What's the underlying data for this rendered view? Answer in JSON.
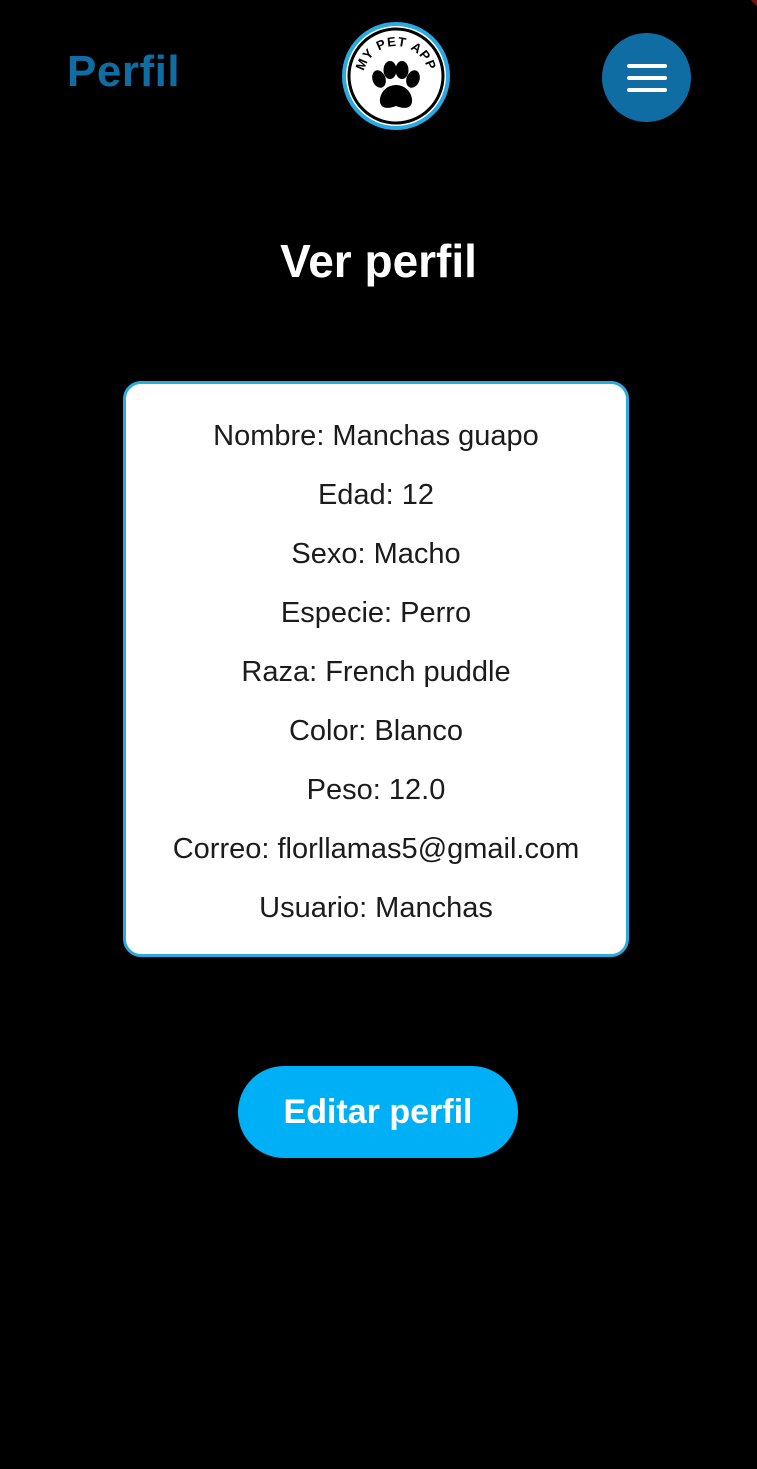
{
  "header": {
    "title": "Perfil",
    "logo_text": "MY PET APP",
    "logo_icon": "paw-icon",
    "menu_icon": "hamburger-menu-icon"
  },
  "page": {
    "title": "Ver perfil"
  },
  "profile": {
    "rows": [
      "Nombre: Manchas guapo",
      "Edad: 12",
      "Sexo: Macho",
      "Especie: Perro",
      "Raza: French puddle",
      "Color: Blanco",
      "Peso: 12.0",
      "Correo: florllamas5@gmail.com",
      "Usuario: Manchas"
    ]
  },
  "actions": {
    "edit_label": "Editar perfil"
  },
  "colors": {
    "background": "#000000",
    "header_accent": "#0f6da3",
    "card_border": "#29aae2",
    "button": "#00b0f6"
  }
}
